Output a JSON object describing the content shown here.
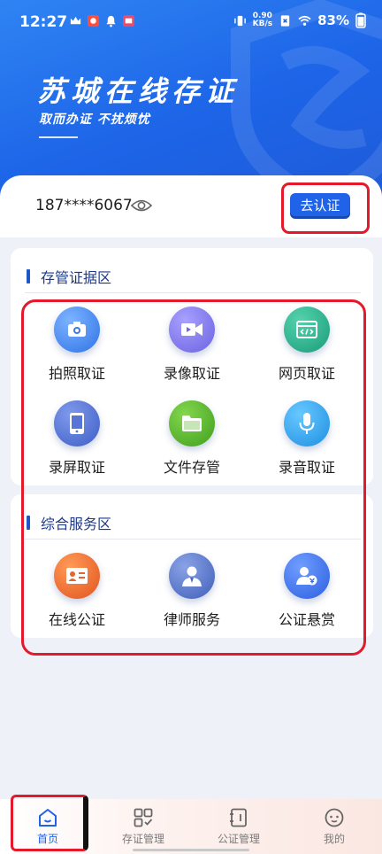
{
  "status_bar": {
    "time": "12:27",
    "net_speed_value": "0.90",
    "net_speed_unit": "KB/s",
    "battery": "83%"
  },
  "header": {
    "title": "苏城在线存证",
    "slogan": "取而办证 不扰烦忧"
  },
  "account": {
    "phone_masked": "187****6067",
    "verify_label": "去认证"
  },
  "evidence_section": {
    "title": "存管证据区",
    "items": [
      {
        "label": "拍照取证",
        "icon": "camera-icon"
      },
      {
        "label": "录像取证",
        "icon": "video-icon"
      },
      {
        "label": "网页取证",
        "icon": "webpage-icon"
      },
      {
        "label": "录屏取证",
        "icon": "phone-screen-icon"
      },
      {
        "label": "文件存管",
        "icon": "folder-icon"
      },
      {
        "label": "录音取证",
        "icon": "microphone-icon"
      }
    ]
  },
  "service_section": {
    "title": "综合服务区",
    "items": [
      {
        "label": "在线公证",
        "icon": "id-card-icon"
      },
      {
        "label": "律师服务",
        "icon": "lawyer-icon"
      },
      {
        "label": "公证悬赏",
        "icon": "reward-user-icon"
      }
    ]
  },
  "bottom_nav": {
    "items": [
      {
        "label": "首页",
        "icon": "home-icon",
        "active": true
      },
      {
        "label": "存证管理",
        "icon": "grid-check-icon",
        "active": false
      },
      {
        "label": "公证管理",
        "icon": "notebook-icon",
        "active": false
      },
      {
        "label": "我的",
        "icon": "smiley-icon",
        "active": false
      }
    ]
  },
  "colors": {
    "brand_blue": "#2163E8",
    "section_title": "#1D3A8A",
    "highlight_red": "#E4192B"
  }
}
